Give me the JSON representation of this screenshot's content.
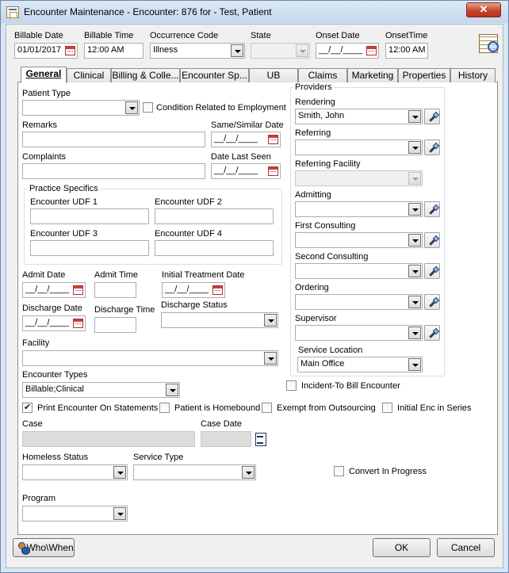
{
  "window": {
    "title": "Encounter Maintenance - Encounter: 876 for - Test, Patient",
    "close_glyph": "✕"
  },
  "header": {
    "billable_date_label": "Billable Date",
    "billable_date_value": "01/01/2017",
    "billable_time_label": "Billable Time",
    "billable_time_value": "12:00 AM",
    "occurrence_code_label": "Occurrence Code",
    "occurrence_code_value": "Illness",
    "state_label": "State",
    "state_value": "",
    "onset_date_label": "Onset Date",
    "onset_date_value": "__/__/____",
    "onset_time_label": "OnsetTime",
    "onset_time_value": "12:00 AM"
  },
  "tabs": [
    {
      "label": "General"
    },
    {
      "label": "Clinical"
    },
    {
      "label": "Billing & Colle..."
    },
    {
      "label": "Encounter  Sp..."
    },
    {
      "label": "UB"
    },
    {
      "label": "Claims"
    },
    {
      "label": "Marketing"
    },
    {
      "label": "Properties"
    },
    {
      "label": "History"
    }
  ],
  "general": {
    "patient_type_label": "Patient Type",
    "condition_employment_label": "Condition Related to Employment",
    "remarks_label": "Remarks",
    "same_similar_date_label": "Same/Similar Date",
    "same_similar_date_value": "__/__/____",
    "complaints_label": "Complaints",
    "date_last_seen_label": "Date Last Seen",
    "date_last_seen_value": "__/__/____",
    "practice_specifics_label": "Practice Specifics",
    "udf1_label": "Encounter UDF 1",
    "udf2_label": "Encounter UDF 2",
    "udf3_label": "Encounter UDF 3",
    "udf4_label": "Encounter UDF 4",
    "admit_date_label": "Admit Date",
    "admit_date_value": "__/__/____",
    "admit_time_label": "Admit Time",
    "initial_treatment_label": "Initial Treatment Date",
    "initial_treatment_value": "__/__/____",
    "discharge_date_label": "Discharge Date",
    "discharge_date_value": "__/__/____",
    "discharge_time_label": "Discharge Time",
    "discharge_status_label": "Discharge Status",
    "facility_label": "Facility",
    "encounter_types_label": "Encounter Types",
    "encounter_types_value": "Billable;Clinical",
    "print_on_statements_label": "Print Encounter On Statements",
    "homebound_label": "Patient is Homebound",
    "exempt_outsourcing_label": "Exempt from Outsourcing",
    "initial_enc_label": "Initial Enc in Series",
    "case_label": "Case",
    "case_date_label": "Case Date",
    "homeless_status_label": "Homeless Status",
    "service_type_label": "Service Type",
    "convert_in_progress_label": "Convert In Progress",
    "program_label": "Program",
    "incident_to_label": "Incident-To Bill Encounter"
  },
  "providers": {
    "group_label": "Providers",
    "rendering_label": "Rendering",
    "rendering_value": "Smith, John",
    "referring_label": "Referring",
    "referring_facility_label": "Referring Facility",
    "admitting_label": "Admitting",
    "first_consulting_label": "First Consulting",
    "second_consulting_label": "Second Consulting",
    "ordering_label": "Ordering",
    "supervisor_label": "Supervisor",
    "service_location_label": "Service Location",
    "service_location_value": "Main Office"
  },
  "footer": {
    "who_when_label": "Who\\When",
    "ok_label": "OK",
    "cancel_label": "Cancel"
  }
}
